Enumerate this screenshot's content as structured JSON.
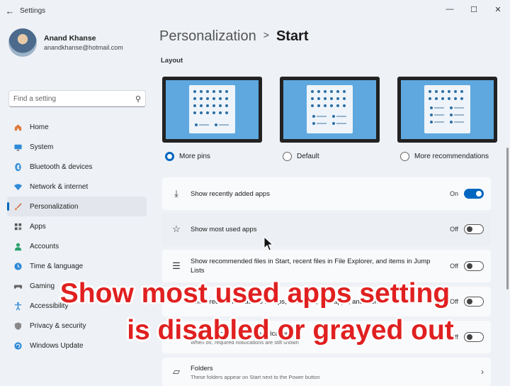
{
  "window": {
    "title": "Settings",
    "back_icon": "arrow-left-icon",
    "controls": [
      "minimize",
      "maximize",
      "close"
    ]
  },
  "profile": {
    "name": "Anand Khanse",
    "email": "anandkhanse@hotmail.com"
  },
  "search": {
    "placeholder": "Find a setting"
  },
  "sidebar": {
    "items": [
      {
        "label": "Home",
        "icon": "home-icon"
      },
      {
        "label": "System",
        "icon": "monitor-icon"
      },
      {
        "label": "Bluetooth & devices",
        "icon": "bluetooth-icon"
      },
      {
        "label": "Network & internet",
        "icon": "wifi-icon"
      },
      {
        "label": "Personalization",
        "icon": "brush-icon",
        "active": true
      },
      {
        "label": "Apps",
        "icon": "apps-icon"
      },
      {
        "label": "Accounts",
        "icon": "person-icon"
      },
      {
        "label": "Time & language",
        "icon": "globe-clock-icon"
      },
      {
        "label": "Gaming",
        "icon": "gamepad-icon"
      },
      {
        "label": "Accessibility",
        "icon": "accessibility-icon"
      },
      {
        "label": "Privacy & security",
        "icon": "shield-icon"
      },
      {
        "label": "Windows Update",
        "icon": "update-icon"
      }
    ]
  },
  "breadcrumb": {
    "parent": "Personalization",
    "separator": ">",
    "current": "Start"
  },
  "layout": {
    "label": "Layout",
    "options": [
      {
        "label": "More pins",
        "selected": true
      },
      {
        "label": "Default",
        "selected": false
      },
      {
        "label": "More recommendations",
        "selected": false
      }
    ]
  },
  "settings": {
    "recently_added": {
      "title": "Show recently added apps",
      "state": "On",
      "icon": "download-icon"
    },
    "most_used": {
      "title": "Show most used apps",
      "state": "Off",
      "icon": "star-icon"
    },
    "recommended_files": {
      "title": "Show recommended files in Start, recent files in File Explorer, and items in Jump Lists",
      "state": "Off",
      "icon": "list-icon"
    },
    "recommendations_tips": {
      "title": "Show recommendations for tips, shortcuts, new apps, and more",
      "state": "Off",
      "icon": "lightbulb-icon"
    },
    "account_notifications": {
      "title": "Show account-related notifications",
      "subtitle": "When off, required notifications are still shown",
      "state": "Off",
      "icon": "account-icon"
    },
    "folders": {
      "title": "Folders",
      "subtitle": "These folders appear on Start next to the Power button",
      "icon": "folder-icon"
    }
  },
  "overlay": {
    "line1": "Show most used apps setting",
    "line2": "is disabled or grayed out"
  },
  "colors": {
    "accent": "#0067c0",
    "overlay_text": "#e02020",
    "background": "#eef1f6"
  }
}
